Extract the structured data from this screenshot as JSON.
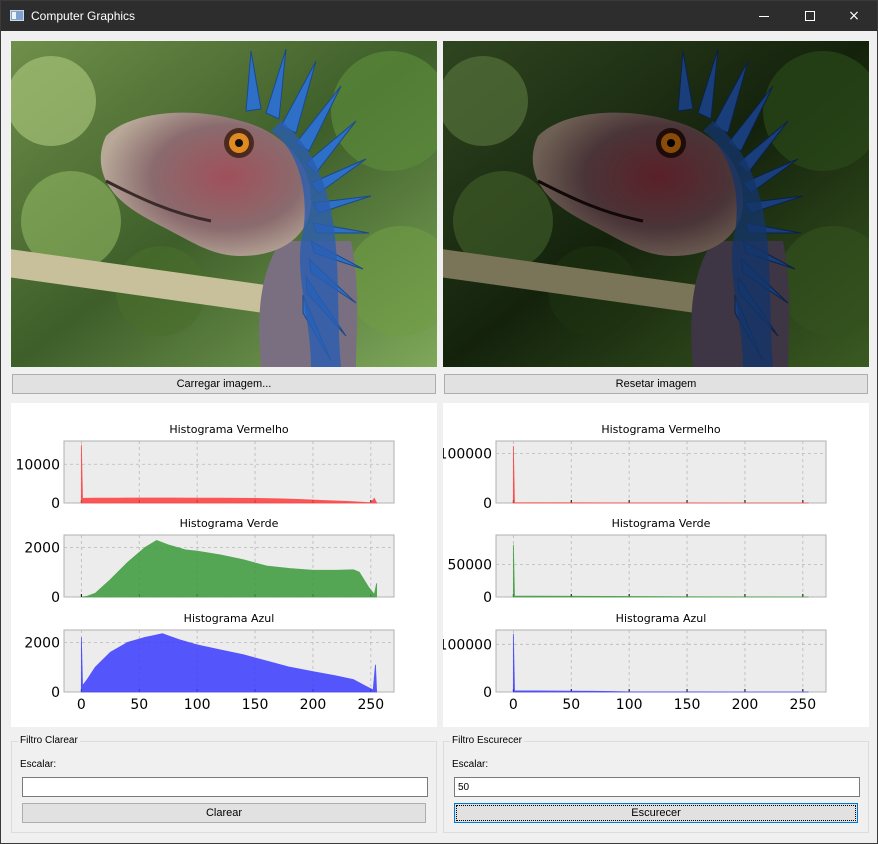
{
  "window": {
    "title": "Computer Graphics"
  },
  "controls": {
    "minimize": "minimize-icon",
    "maximize": "maximize-icon",
    "close": "×"
  },
  "images": {
    "original_alt": "original dinosaur image",
    "processed_alt": "darkened dinosaur image"
  },
  "buttons": {
    "load": "Carregar imagem...",
    "reset": "Resetar imagem",
    "clarear": "Clarear",
    "escurecer": "Escurecer"
  },
  "filters": {
    "clarear": {
      "title": "Filtro Clarear",
      "label": "Escalar:",
      "value": ""
    },
    "escurecer": {
      "title": "Filtro Escurecer",
      "label": "Escalar:",
      "value": "50"
    }
  },
  "colors": {
    "red": "#ff3b3b",
    "green": "#3a9a3a",
    "blue": "#3b3bff",
    "plot_bg": "#ececec"
  },
  "chart_data": [
    {
      "panel": "left",
      "type": "area",
      "x_ticks": [
        0,
        50,
        100,
        150,
        200,
        250
      ],
      "xlim": [
        -15,
        270
      ],
      "series": [
        {
          "title": "Histograma Vermelho",
          "color": "#ff3b3b",
          "ylim": [
            0,
            16000
          ],
          "y_ticks": [
            0,
            10000
          ],
          "y_tick_labels": [
            "0",
            "10000"
          ],
          "points": [
            [
              0,
              15000
            ],
            [
              1,
              1200
            ],
            [
              10,
              1250
            ],
            [
              30,
              1250
            ],
            [
              50,
              1300
            ],
            [
              80,
              1300
            ],
            [
              100,
              1250
            ],
            [
              120,
              1250
            ],
            [
              150,
              1200
            ],
            [
              170,
              1100
            ],
            [
              190,
              900
            ],
            [
              210,
              650
            ],
            [
              230,
              400
            ],
            [
              245,
              150
            ],
            [
              250,
              100
            ],
            [
              253,
              1200
            ],
            [
              255,
              0
            ]
          ]
        },
        {
          "title": "Histograma Verde",
          "color": "#3a9a3a",
          "ylim": [
            0,
            2500
          ],
          "y_ticks": [
            0,
            2000
          ],
          "y_tick_labels": [
            "0",
            "2000"
          ],
          "points": [
            [
              0,
              0
            ],
            [
              5,
              30
            ],
            [
              12,
              150
            ],
            [
              25,
              700
            ],
            [
              40,
              1400
            ],
            [
              55,
              2000
            ],
            [
              65,
              2280
            ],
            [
              75,
              2100
            ],
            [
              90,
              1900
            ],
            [
              100,
              1850
            ],
            [
              120,
              1700
            ],
            [
              140,
              1500
            ],
            [
              160,
              1250
            ],
            [
              180,
              1150
            ],
            [
              200,
              1080
            ],
            [
              220,
              1080
            ],
            [
              235,
              1100
            ],
            [
              240,
              1000
            ],
            [
              248,
              400
            ],
            [
              253,
              100
            ],
            [
              255,
              550
            ]
          ]
        },
        {
          "title": "Histograma Azul",
          "color": "#3b3bff",
          "ylim": [
            0,
            2500
          ],
          "y_ticks": [
            0,
            2000
          ],
          "y_tick_labels": [
            "0",
            "2000"
          ],
          "points": [
            [
              0,
              2200
            ],
            [
              1,
              250
            ],
            [
              5,
              500
            ],
            [
              12,
              1000
            ],
            [
              25,
              1600
            ],
            [
              40,
              2000
            ],
            [
              55,
              2200
            ],
            [
              70,
              2350
            ],
            [
              85,
              2100
            ],
            [
              100,
              1900
            ],
            [
              120,
              1700
            ],
            [
              140,
              1500
            ],
            [
              160,
              1250
            ],
            [
              180,
              1000
            ],
            [
              200,
              820
            ],
            [
              220,
              650
            ],
            [
              235,
              500
            ],
            [
              245,
              250
            ],
            [
              252,
              80
            ],
            [
              254,
              1100
            ],
            [
              255,
              0
            ]
          ]
        }
      ]
    },
    {
      "panel": "right",
      "type": "area",
      "x_ticks": [
        0,
        50,
        100,
        150,
        200,
        250
      ],
      "xlim": [
        -15,
        270
      ],
      "series": [
        {
          "title": "Histograma Vermelho",
          "color": "#ff3b3b",
          "ylim": [
            0,
            125000
          ],
          "y_ticks": [
            0,
            100000
          ],
          "y_tick_labels": [
            "0",
            "100000"
          ],
          "points": [
            [
              0,
              115000
            ],
            [
              1,
              600
            ],
            [
              20,
              500
            ],
            [
              50,
              400
            ],
            [
              80,
              300
            ],
            [
              100,
              200
            ],
            [
              150,
              120
            ],
            [
              200,
              60
            ],
            [
              250,
              20
            ],
            [
              255,
              0
            ]
          ]
        },
        {
          "title": "Histograma Verde",
          "color": "#3a9a3a",
          "ylim": [
            0,
            95000
          ],
          "y_ticks": [
            0,
            50000
          ],
          "y_tick_labels": [
            "0",
            "50000"
          ],
          "points": [
            [
              0,
              80000
            ],
            [
              1,
              1500
            ],
            [
              20,
              1300
            ],
            [
              50,
              1100
            ],
            [
              80,
              900
            ],
            [
              100,
              700
            ],
            [
              130,
              500
            ],
            [
              150,
              300
            ],
            [
              200,
              150
            ],
            [
              250,
              40
            ],
            [
              255,
              0
            ]
          ]
        },
        {
          "title": "Histograma Azul",
          "color": "#3b3bff",
          "ylim": [
            0,
            130000
          ],
          "y_ticks": [
            0,
            100000
          ],
          "y_tick_labels": [
            "0",
            "100000"
          ],
          "points": [
            [
              0,
              122000
            ],
            [
              1,
              2500
            ],
            [
              20,
              2200
            ],
            [
              50,
              1800
            ],
            [
              70,
              1400
            ],
            [
              85,
              900
            ],
            [
              100,
              300
            ],
            [
              150,
              80
            ],
            [
              200,
              30
            ],
            [
              255,
              0
            ]
          ]
        }
      ]
    }
  ]
}
